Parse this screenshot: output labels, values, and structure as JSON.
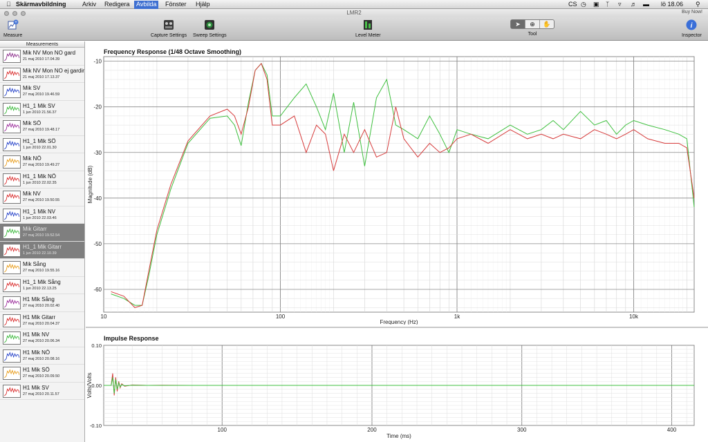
{
  "menubar": {
    "apple": "",
    "app_name": "Skärmavbildning",
    "items": [
      "Arkiv",
      "Redigera",
      "Avbilda",
      "Fönster",
      "Hjälp"
    ],
    "active_item": "Avbilda",
    "clock": "lö 18.06",
    "status_text": "CS"
  },
  "window": {
    "title": "LMR2",
    "buy_now": "Buy Now!"
  },
  "toolbar": {
    "measure_label": "Measure",
    "capture_label": "Capture Settings",
    "sweep_label": "Sweep Settings",
    "level_label": "Level Meter",
    "tool_label": "Tool",
    "inspector_label": "Inspector"
  },
  "sidebar": {
    "header": "Measurements",
    "items": [
      {
        "name": "Mik NV Mon NO gard",
        "date": "21 maj 2010 17.04.39",
        "color": "#8a2a8a"
      },
      {
        "name": "Mik NV Mon NO ej gardin",
        "date": "21 maj 2010 17.13.37",
        "color": "#d92a2a"
      },
      {
        "name": "Mik SV",
        "date": "27 maj 2010 19.46.59",
        "color": "#2440c8"
      },
      {
        "name": "H1_1 Mik SV",
        "date": "1 jun 2010 21.56.37",
        "color": "#38b838"
      },
      {
        "name": "Mik SÖ",
        "date": "27 maj 2010 19.48.17",
        "color": "#9a2a9a"
      },
      {
        "name": "H1_1 Mik SÖ",
        "date": "1 jun 2010 22.01.30",
        "color": "#2440c8"
      },
      {
        "name": "Mik NÖ",
        "date": "27 maj 2010 19.49.27",
        "color": "#e89c1a"
      },
      {
        "name": "H1_1 Mik NÖ",
        "date": "1 jun 2010 22.02.35",
        "color": "#d92a2a"
      },
      {
        "name": "Mik NV",
        "date": "27 maj 2010 19.50.55",
        "color": "#d92a2a"
      },
      {
        "name": "H1_1 Mik NV",
        "date": "1 jun 2010 22.03.46",
        "color": "#2440c8"
      },
      {
        "name": "Mik Gitarr",
        "date": "27 maj 2010 19.52.54",
        "color": "#38b838"
      },
      {
        "name": "H1_1 Mik Gitarr",
        "date": "1 jun 2010 22.10.39",
        "color": "#d92a2a"
      },
      {
        "name": "Mik Sång",
        "date": "27 maj 2010 19.55.16",
        "color": "#e89c1a"
      },
      {
        "name": "H1_1 Mik Sång",
        "date": "1 jun 2010 22.13.25",
        "color": "#d92a2a"
      },
      {
        "name": "H1 Mik Sång",
        "date": "27 maj 2010 20.02.40",
        "color": "#9a2a9a"
      },
      {
        "name": "H1 Mik Gitarr",
        "date": "27 maj 2010 20.04.37",
        "color": "#d92a2a"
      },
      {
        "name": "H1 Mik NV",
        "date": "27 maj 2010 20.06.34",
        "color": "#38b838"
      },
      {
        "name": "H1 Mik NÖ",
        "date": "27 maj 2010 20.08.16",
        "color": "#2440c8"
      },
      {
        "name": "H1 Mik SÖ",
        "date": "27 maj 2010 20.09.50",
        "color": "#e89c1a"
      },
      {
        "name": "H1 Mik SV",
        "date": "27 maj 2010 20.11.57",
        "color": "#d92a2a"
      }
    ],
    "selected": [
      10,
      11
    ]
  },
  "chart_data": [
    {
      "type": "line",
      "title": "Frequency Response (1/48 Octave Smoothing)",
      "xlabel": "Frequency (Hz)",
      "ylabel": "Magnitude (dB)",
      "xscale": "log",
      "xlim": [
        10,
        22000
      ],
      "ylim": [
        -65,
        -9
      ],
      "xticks": [
        10,
        100,
        1000,
        10000
      ],
      "xtick_labels": [
        "10",
        "100",
        "1k",
        "10k"
      ],
      "yticks": [
        -10,
        -20,
        -30,
        -40,
        -50,
        -60
      ],
      "grid": true,
      "series": [
        {
          "color": "#3cbf3c",
          "x": [
            11,
            13,
            15,
            16.5,
            18,
            20,
            24,
            30,
            40,
            50,
            55,
            60,
            66,
            72,
            78,
            84,
            90,
            100,
            120,
            140,
            160,
            180,
            200,
            230,
            260,
            300,
            350,
            400,
            450,
            500,
            600,
            700,
            800,
            900,
            1000,
            1200,
            1500,
            2000,
            2500,
            3000,
            3500,
            4000,
            5000,
            6000,
            7000,
            8000,
            9000,
            10000,
            12000,
            15000,
            18000,
            20000,
            22000
          ],
          "y": [
            -61,
            -62,
            -63.5,
            -63.5,
            -57,
            -48,
            -38,
            -28,
            -22.5,
            -22,
            -24,
            -28.5,
            -19,
            -12,
            -10.5,
            -13,
            -22,
            -22,
            -18,
            -15,
            -20,
            -25,
            -17,
            -30,
            -19,
            -33,
            -18,
            -14,
            -24,
            -25,
            -27,
            -22,
            -26,
            -30,
            -25,
            -26,
            -27,
            -24,
            -26,
            -25,
            -23,
            -25,
            -21,
            -24,
            -23,
            -26,
            -24,
            -23,
            -24,
            -25,
            -26,
            -27,
            -42
          ]
        },
        {
          "color": "#d63a3a",
          "x": [
            11,
            13,
            15,
            16.5,
            18,
            20,
            24,
            30,
            40,
            50,
            55,
            60,
            66,
            72,
            78,
            84,
            90,
            100,
            120,
            140,
            160,
            180,
            200,
            230,
            260,
            300,
            350,
            400,
            450,
            500,
            600,
            700,
            800,
            900,
            1000,
            1200,
            1500,
            2000,
            2500,
            3000,
            3500,
            4000,
            5000,
            6000,
            7000,
            8000,
            9000,
            10000,
            12000,
            15000,
            18000,
            20000,
            22000
          ],
          "y": [
            -60.5,
            -61.5,
            -64,
            -63.5,
            -56,
            -47,
            -37,
            -27.5,
            -22,
            -20.5,
            -22,
            -26,
            -20,
            -12,
            -10.5,
            -14,
            -24,
            -24,
            -22,
            -30,
            -24,
            -26,
            -34,
            -26,
            -30,
            -25,
            -31,
            -30,
            -20,
            -27,
            -31,
            -28,
            -30,
            -29,
            -27,
            -26,
            -28,
            -25,
            -27,
            -26,
            -27,
            -26,
            -27,
            -25,
            -26,
            -27,
            -26,
            -25,
            -27,
            -28,
            -28,
            -29,
            -40
          ]
        }
      ]
    },
    {
      "type": "line",
      "title": "Impulse Response",
      "xlabel": "Time (ms)",
      "ylabel": "Volts/Volts",
      "xlim": [
        21,
        415
      ],
      "ylim": [
        -0.1,
        0.1
      ],
      "xticks": [
        100,
        200,
        300,
        400
      ],
      "yticks": [
        0.1,
        0.0,
        -0.1
      ],
      "ytick_labels": [
        "0.10",
        "0.00",
        "-0.10"
      ],
      "grid": true,
      "series": [
        {
          "color": "#d63a3a",
          "x": [
            21,
            26,
            27,
            28,
            29,
            30,
            31,
            32,
            33,
            35,
            40,
            50,
            60,
            80,
            120,
            200,
            300,
            415
          ],
          "y": [
            0,
            0,
            0.03,
            -0.025,
            0.02,
            -0.015,
            0.01,
            -0.006,
            0.004,
            -0.002,
            0.001,
            0,
            0.0005,
            0,
            0,
            0,
            0,
            0
          ]
        },
        {
          "color": "#3cbf3c",
          "x": [
            21,
            26,
            27,
            28,
            29,
            30,
            31,
            32,
            33,
            35,
            40,
            50,
            415
          ],
          "y": [
            0,
            0,
            0.02,
            -0.02,
            0.015,
            -0.01,
            0.006,
            -0.004,
            0.002,
            -0.001,
            0.0005,
            0,
            0
          ]
        }
      ]
    }
  ]
}
